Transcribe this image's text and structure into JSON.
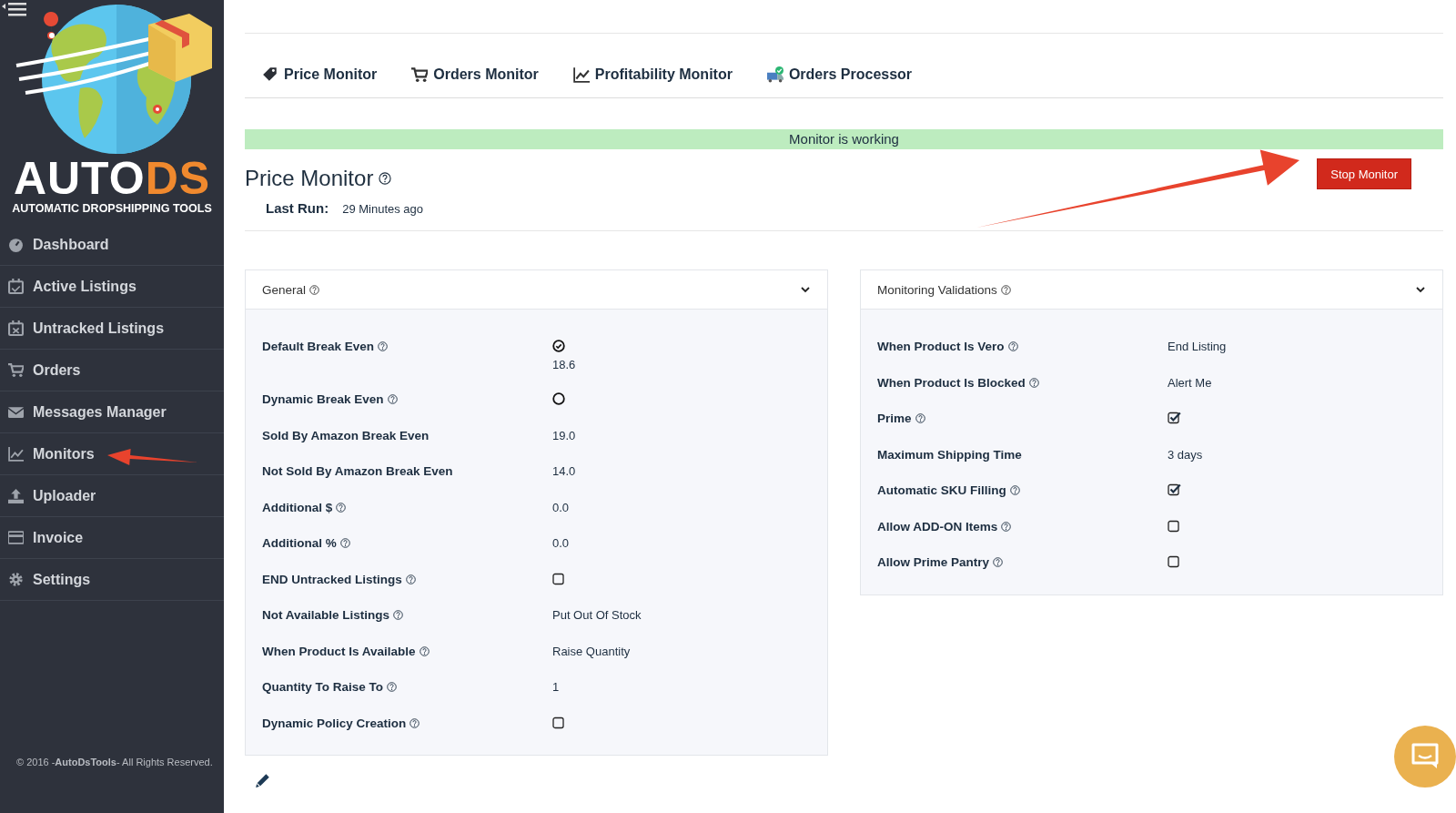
{
  "sidebar": {
    "logo": {
      "word_main": "AUTO",
      "word_accent": "DS",
      "tagline": "AUTOMATIC DROPSHIPPING TOOLS"
    },
    "items": [
      {
        "label": "Dashboard"
      },
      {
        "label": "Active Listings"
      },
      {
        "label": "Untracked Listings"
      },
      {
        "label": "Orders"
      },
      {
        "label": "Messages Manager"
      },
      {
        "label": "Monitors"
      },
      {
        "label": "Uploader"
      },
      {
        "label": "Invoice"
      },
      {
        "label": "Settings"
      }
    ],
    "footer": "© 2016 -**AutoDsTools**- All Rights Reserved."
  },
  "tabs": [
    {
      "label": "Price Monitor"
    },
    {
      "label": "Orders Monitor"
    },
    {
      "label": "Profitability Monitor"
    },
    {
      "label": "Orders Processor"
    }
  ],
  "status_banner": "Monitor is working",
  "page_title": "Price Monitor",
  "last_run": {
    "label": "Last Run:",
    "value": "29 Minutes ago"
  },
  "stop_button": "Stop Monitor",
  "cards": [
    {
      "title": "General",
      "rows": [
        {
          "label": "Default Break Even",
          "help": true,
          "kind": "radio",
          "checked": true,
          "value": "18.6"
        },
        {
          "label": "Dynamic Break Even",
          "help": true,
          "kind": "radio",
          "checked": false
        },
        {
          "label": "Sold By Amazon Break Even",
          "help": false,
          "kind": "text",
          "value": "19.0"
        },
        {
          "label": "Not Sold By Amazon Break Even",
          "help": false,
          "kind": "text",
          "value": "14.0"
        },
        {
          "label": "Additional $",
          "help": true,
          "kind": "text",
          "value": "0.0"
        },
        {
          "label": "Additional %",
          "help": true,
          "kind": "text",
          "value": "0.0"
        },
        {
          "label": "END Untracked Listings",
          "help": true,
          "kind": "checkbox",
          "checked": false
        },
        {
          "label": "Not Available Listings",
          "help": true,
          "kind": "text",
          "value": "Put Out Of Stock"
        },
        {
          "label": "When Product Is Available",
          "help": true,
          "kind": "text",
          "value": "Raise Quantity"
        },
        {
          "label": "Quantity To Raise To",
          "help": true,
          "kind": "text",
          "value": "1"
        },
        {
          "label": "Dynamic Policy Creation",
          "help": true,
          "kind": "checkbox",
          "checked": false
        }
      ]
    },
    {
      "title": "Monitoring Validations",
      "rows": [
        {
          "label": "When Product Is Vero",
          "help": true,
          "kind": "text",
          "value": "End Listing"
        },
        {
          "label": "When Product Is Blocked",
          "help": true,
          "kind": "text",
          "value": "Alert Me"
        },
        {
          "label": "Prime",
          "help": true,
          "kind": "checkbox",
          "checked": true
        },
        {
          "label": "Maximum Shipping Time",
          "help": false,
          "kind": "text",
          "value": "3 days"
        },
        {
          "label": "Automatic SKU Filling",
          "help": true,
          "kind": "checkbox",
          "checked": true
        },
        {
          "label": "Allow ADD-ON Items",
          "help": true,
          "kind": "checkbox",
          "checked": false
        },
        {
          "label": "Allow Prime Pantry",
          "help": true,
          "kind": "checkbox",
          "checked": false
        }
      ]
    }
  ]
}
